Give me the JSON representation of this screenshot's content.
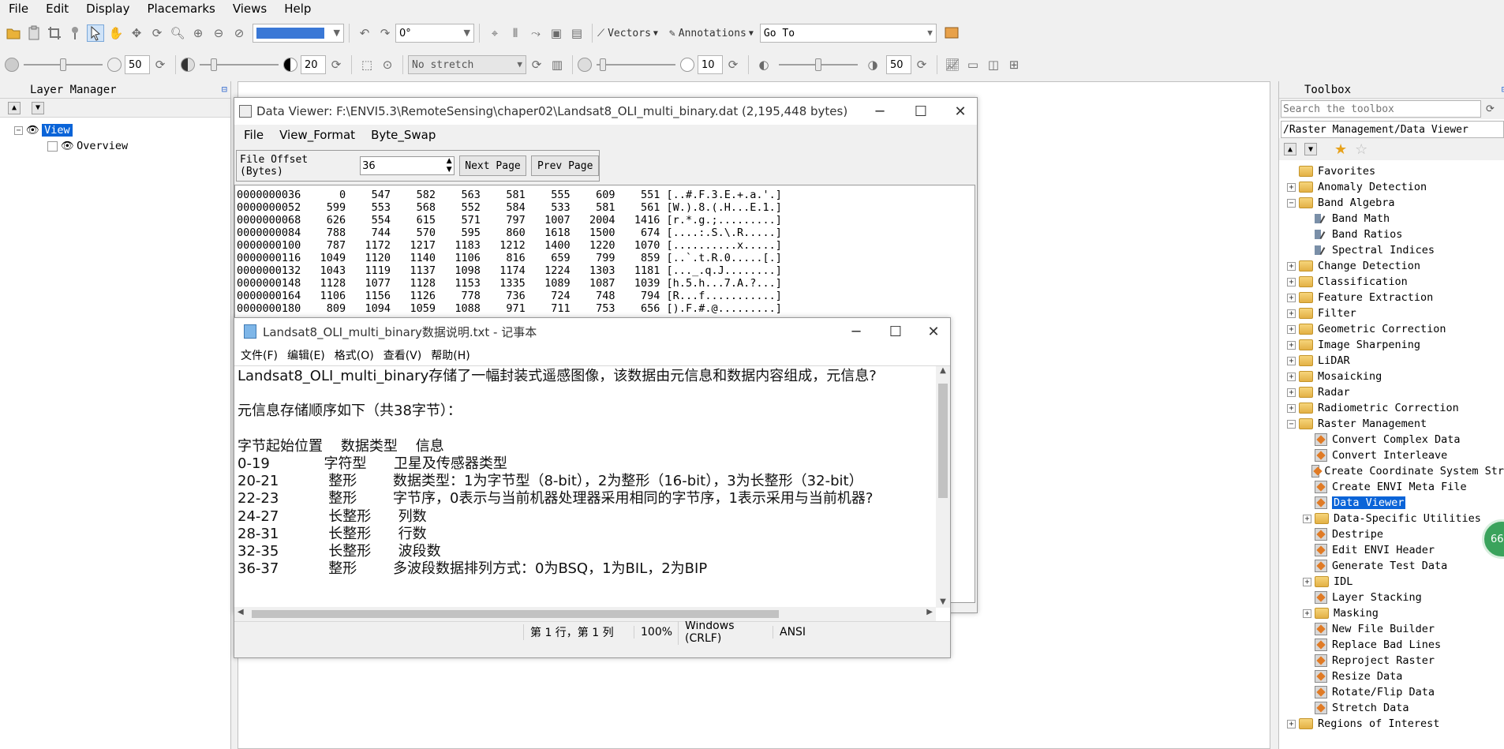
{
  "menubar": [
    "File",
    "Edit",
    "Display",
    "Placemarks",
    "Views",
    "Help"
  ],
  "toolbar1": {
    "zoom_value": "",
    "rotation": "0°",
    "vectors": "Vectors",
    "annotations": "Annotations",
    "goto": "Go To"
  },
  "toolbar2": {
    "brightness": "50",
    "contrast": "20",
    "stretch": "No stretch",
    "sharpen": "10",
    "transparency": "50"
  },
  "layer_manager": {
    "title": "Layer Manager",
    "view": "View",
    "overview": "Overview"
  },
  "toolbox": {
    "title": "Toolbox",
    "search_placeholder": "Search the toolbox",
    "path": "/Raster Management/Data Viewer",
    "items": [
      {
        "label": "Favorites",
        "kind": "folder",
        "exp": ""
      },
      {
        "label": "Anomaly Detection",
        "kind": "folder",
        "exp": "+"
      },
      {
        "label": "Band Algebra",
        "kind": "folder",
        "exp": "−"
      },
      {
        "label": "Band Math",
        "kind": "band",
        "exp": "",
        "indent": 1
      },
      {
        "label": "Band Ratios",
        "kind": "band",
        "exp": "",
        "indent": 1
      },
      {
        "label": "Spectral Indices",
        "kind": "band",
        "exp": "",
        "indent": 1
      },
      {
        "label": "Change Detection",
        "kind": "folder",
        "exp": "+"
      },
      {
        "label": "Classification",
        "kind": "folder",
        "exp": "+"
      },
      {
        "label": "Feature Extraction",
        "kind": "folder",
        "exp": "+"
      },
      {
        "label": "Filter",
        "kind": "folder",
        "exp": "+"
      },
      {
        "label": "Geometric Correction",
        "kind": "folder",
        "exp": "+"
      },
      {
        "label": "Image Sharpening",
        "kind": "folder",
        "exp": "+"
      },
      {
        "label": "LiDAR",
        "kind": "folder",
        "exp": "+"
      },
      {
        "label": "Mosaicking",
        "kind": "folder",
        "exp": "+"
      },
      {
        "label": "Radar",
        "kind": "folder",
        "exp": "+"
      },
      {
        "label": "Radiometric Correction",
        "kind": "folder",
        "exp": "+"
      },
      {
        "label": "Raster Management",
        "kind": "folder",
        "exp": "−"
      },
      {
        "label": "Convert Complex Data",
        "kind": "tool",
        "exp": "",
        "indent": 1
      },
      {
        "label": "Convert Interleave",
        "kind": "tool",
        "exp": "",
        "indent": 1
      },
      {
        "label": "Create Coordinate System Str",
        "kind": "tool",
        "exp": "",
        "indent": 1
      },
      {
        "label": "Create ENVI Meta File",
        "kind": "tool",
        "exp": "",
        "indent": 1
      },
      {
        "label": "Data Viewer",
        "kind": "tool",
        "exp": "",
        "indent": 1,
        "selected": true
      },
      {
        "label": "Data-Specific Utilities",
        "kind": "folder",
        "exp": "+",
        "indent": 1
      },
      {
        "label": "Destripe",
        "kind": "tool",
        "exp": "",
        "indent": 1
      },
      {
        "label": "Edit ENVI Header",
        "kind": "tool",
        "exp": "",
        "indent": 1
      },
      {
        "label": "Generate Test Data",
        "kind": "tool",
        "exp": "",
        "indent": 1
      },
      {
        "label": "IDL",
        "kind": "folder",
        "exp": "+",
        "indent": 1
      },
      {
        "label": "Layer Stacking",
        "kind": "tool",
        "exp": "",
        "indent": 1
      },
      {
        "label": "Masking",
        "kind": "folder",
        "exp": "+",
        "indent": 1
      },
      {
        "label": "New File Builder",
        "kind": "tool",
        "exp": "",
        "indent": 1
      },
      {
        "label": "Replace Bad Lines",
        "kind": "tool",
        "exp": "",
        "indent": 1
      },
      {
        "label": "Reproject Raster",
        "kind": "tool",
        "exp": "",
        "indent": 1
      },
      {
        "label": "Resize Data",
        "kind": "tool",
        "exp": "",
        "indent": 1
      },
      {
        "label": "Rotate/Flip Data",
        "kind": "tool",
        "exp": "",
        "indent": 1
      },
      {
        "label": "Stretch Data",
        "kind": "tool",
        "exp": "",
        "indent": 1
      },
      {
        "label": "Regions of Interest",
        "kind": "folder",
        "exp": "+"
      }
    ]
  },
  "data_viewer": {
    "title": "Data Viewer: F:\\ENVI5.3\\RemoteSensing\\chaper02\\Landsat8_OLI_multi_binary.dat (2,195,448 bytes)",
    "menu": [
      "File",
      "View_Format",
      "Byte_Swap"
    ],
    "offset_label": "File Offset (Bytes)",
    "offset_value": "36",
    "next_page": "Next Page",
    "prev_page": "Prev Page",
    "rows": [
      "0000000036      0    547    582    563    581    555    609    551 [..#.F.3.E.+.a.'.]",
      "0000000052    599    553    568    552    584    533    581    561 [W.).8.(.H...E.1.]",
      "0000000068    626    554    615    571    797   1007   2004   1416 [r.*.g.;.........]",
      "0000000084    788    744    570    595    860   1618   1500    674 [....:.S.\\.R.....]",
      "0000000100    787   1172   1217   1183   1212   1400   1220   1070 [..........x.....]",
      "0000000116   1049   1120   1140   1106    816    659    799    859 [..`.t.R.0.....[.]",
      "0000000132   1043   1119   1137   1098   1174   1224   1303   1181 [..._.q.J........]",
      "0000000148   1128   1077   1128   1153   1335   1089   1087   1039 [h.5.h...7.A.?...]",
      "0000000164   1106   1156   1126    778    736    724    748    794 [R...f...........]",
      "0000000180    809   1094   1059   1088    971    711    753    656 [).F.#.@.........]"
    ]
  },
  "notepad": {
    "title": "Landsat8_OLI_multi_binary数据说明.txt - 记事本",
    "menu": [
      "文件(F)",
      "编辑(E)",
      "格式(O)",
      "查看(V)",
      "帮助(H)"
    ],
    "lines": [
      "Landsat8_OLI_multi_binary存储了一幅封装式遥感图像，该数据由元信息和数据内容组成，元信息?",
      "",
      "元信息存储顺序如下（共38字节）：",
      "",
      "字节起始位置    数据类型    信息",
      "0-19            字符型      卫星及传感器类型",
      "20-21           整形        数据类型：1为字节型（8-bit），2为整形（16-bit），3为长整形（32-bit）",
      "22-23           整形        字节序，0表示与当前机器处理器采用相同的字节序，1表示采用与当前机器?",
      "24-27           长整形      列数",
      "28-31           长整形      行数",
      "32-35           长整形      波段数",
      "36-37           整形        多波段数据排列方式：0为BSQ，1为BIL，2为BIP"
    ],
    "status": [
      "第 1 行，第 1 列",
      "100%",
      "Windows (CRLF)",
      "ANSI"
    ]
  },
  "colors": {
    "selection": "#0a64d8",
    "folder": "#f0c75e",
    "badge": "#3aa35c"
  },
  "badge_text": "66"
}
